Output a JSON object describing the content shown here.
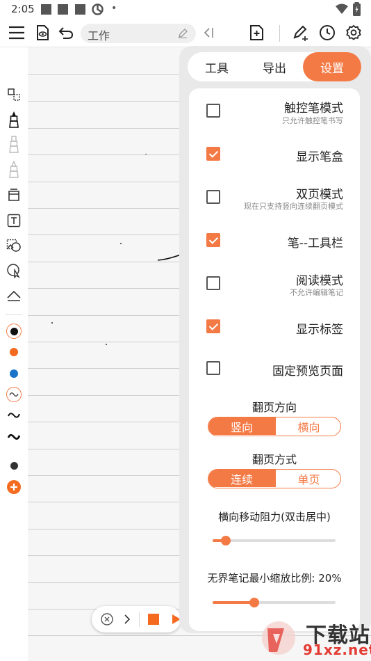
{
  "status_bar": {
    "time": "2:05",
    "dot": "•"
  },
  "toolbar": {
    "title": "工作",
    "icons": [
      "menu-icon",
      "eye-doc-icon",
      "undo-icon",
      "edit-pencil-icon",
      "collapse-left-icon",
      "add-page-icon",
      "pen-plus-icon",
      "clock-icon",
      "gear-icon"
    ]
  },
  "left_toolbar": {
    "colors": {
      "black": "#111111",
      "orange": "#f46b1f",
      "blue": "#1a73c8",
      "accent": "#f47a45",
      "add": "#f46b1f"
    }
  },
  "settings_panel": {
    "tabs": [
      {
        "label": "工具",
        "active": false
      },
      {
        "label": "导出",
        "active": false
      },
      {
        "label": "设置",
        "active": true
      }
    ],
    "options": [
      {
        "title": "触控笔模式",
        "subtitle": "只允许触控笔书写",
        "checked": false
      },
      {
        "title": "显示笔盒",
        "subtitle": "",
        "checked": true
      },
      {
        "title": "双页模式",
        "subtitle": "现在只支持竖向连续翻页模式",
        "checked": false
      },
      {
        "title": "笔--工具栏",
        "subtitle": "",
        "checked": true
      },
      {
        "title": "阅读模式",
        "subtitle": "不允许编辑笔记",
        "checked": false
      },
      {
        "title": "显示标签",
        "subtitle": "",
        "checked": true
      },
      {
        "title": "固定预览页面",
        "subtitle": "",
        "checked": false
      }
    ],
    "page_direction": {
      "label": "翻页方向",
      "options": [
        "竖向",
        "横向"
      ],
      "selected": "竖向"
    },
    "page_mode": {
      "label": "翻页方式",
      "options": [
        "连续",
        "单页"
      ],
      "selected": "连续"
    },
    "horizontal_resistance": {
      "label": "横向移动阻力(双击居中)",
      "value": 0.11
    },
    "min_zoom": {
      "label": "无界笔记最小缩放比例: 20%",
      "value": 0.34
    }
  },
  "watermark": {
    "line1": "下载站",
    "line2": "91xz.net"
  }
}
